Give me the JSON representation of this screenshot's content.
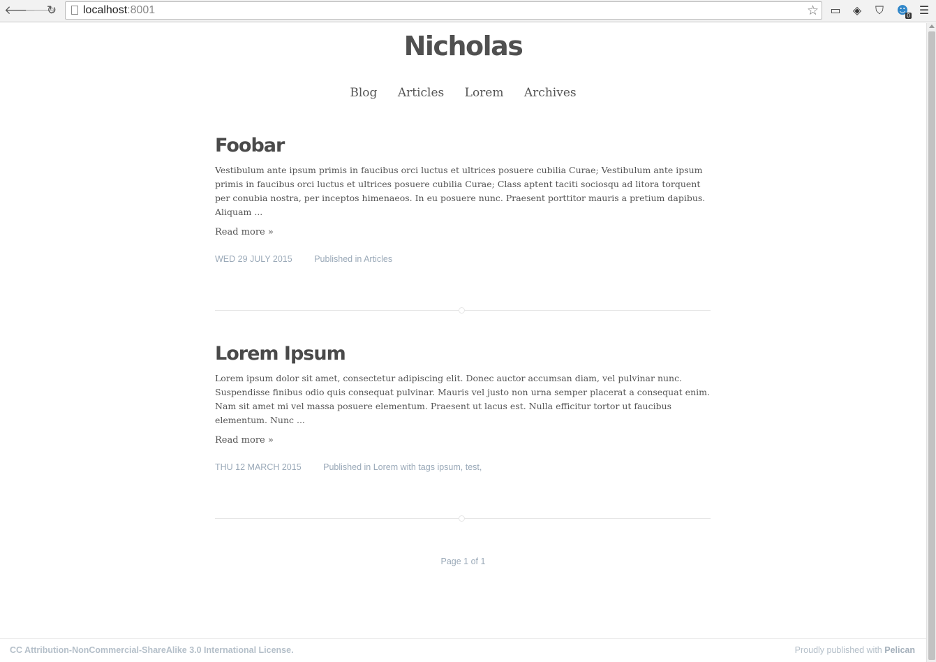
{
  "browser": {
    "url_host": "localhost",
    "url_port": ":8001",
    "extensions": [
      {
        "name": "cast-icon",
        "glyph": "▭"
      },
      {
        "name": "layers-icon",
        "glyph": "◈"
      },
      {
        "name": "pocket-icon",
        "glyph": "⛉"
      },
      {
        "name": "ghostery-icon",
        "glyph": "☻",
        "badge": "0"
      }
    ]
  },
  "site": {
    "title": "Nicholas",
    "nav": [
      "Blog",
      "Articles",
      "Lorem",
      "Archives"
    ]
  },
  "articles": [
    {
      "title": "Foobar",
      "summary": "Vestibulum ante ipsum primis in faucibus orci luctus et ultrices posuere cubilia Curae; Vestibulum ante ipsum primis in faucibus orci luctus et ultrices posuere cubilia Curae; Class aptent taciti sociosqu ad litora torquent per conubia nostra, per inceptos himenaeos. In eu posuere nunc. Praesent porttitor mauris a pretium dapibus. Aliquam ...",
      "read_more": "Read more »",
      "date": "WED 29 JULY 2015",
      "published_prefix": "Published in ",
      "category": "Articles",
      "tags_prefix": "",
      "tags": ""
    },
    {
      "title": "Lorem Ipsum",
      "summary": "Lorem ipsum dolor sit amet, consectetur adipiscing elit. Donec auctor accumsan diam, vel pulvinar nunc. Suspendisse finibus odio quis consequat pulvinar. Mauris vel justo non urna semper placerat a consequat enim. Nam sit amet mi vel massa posuere elementum. Praesent ut lacus est. Nulla efficitur tortor ut faucibus elementum. Nunc ...",
      "read_more": "Read more »",
      "date": "THU 12 MARCH 2015",
      "published_prefix": "Published in ",
      "category": "Lorem",
      "tags_prefix": " with tags ",
      "tags": "ipsum, test,"
    }
  ],
  "pager": "Page 1 of 1",
  "footer": {
    "license": "CC Attribution-NonCommercial-ShareAlike 3.0 International License.",
    "powered_prefix": "Proudly published with ",
    "powered_link": "Pelican"
  }
}
